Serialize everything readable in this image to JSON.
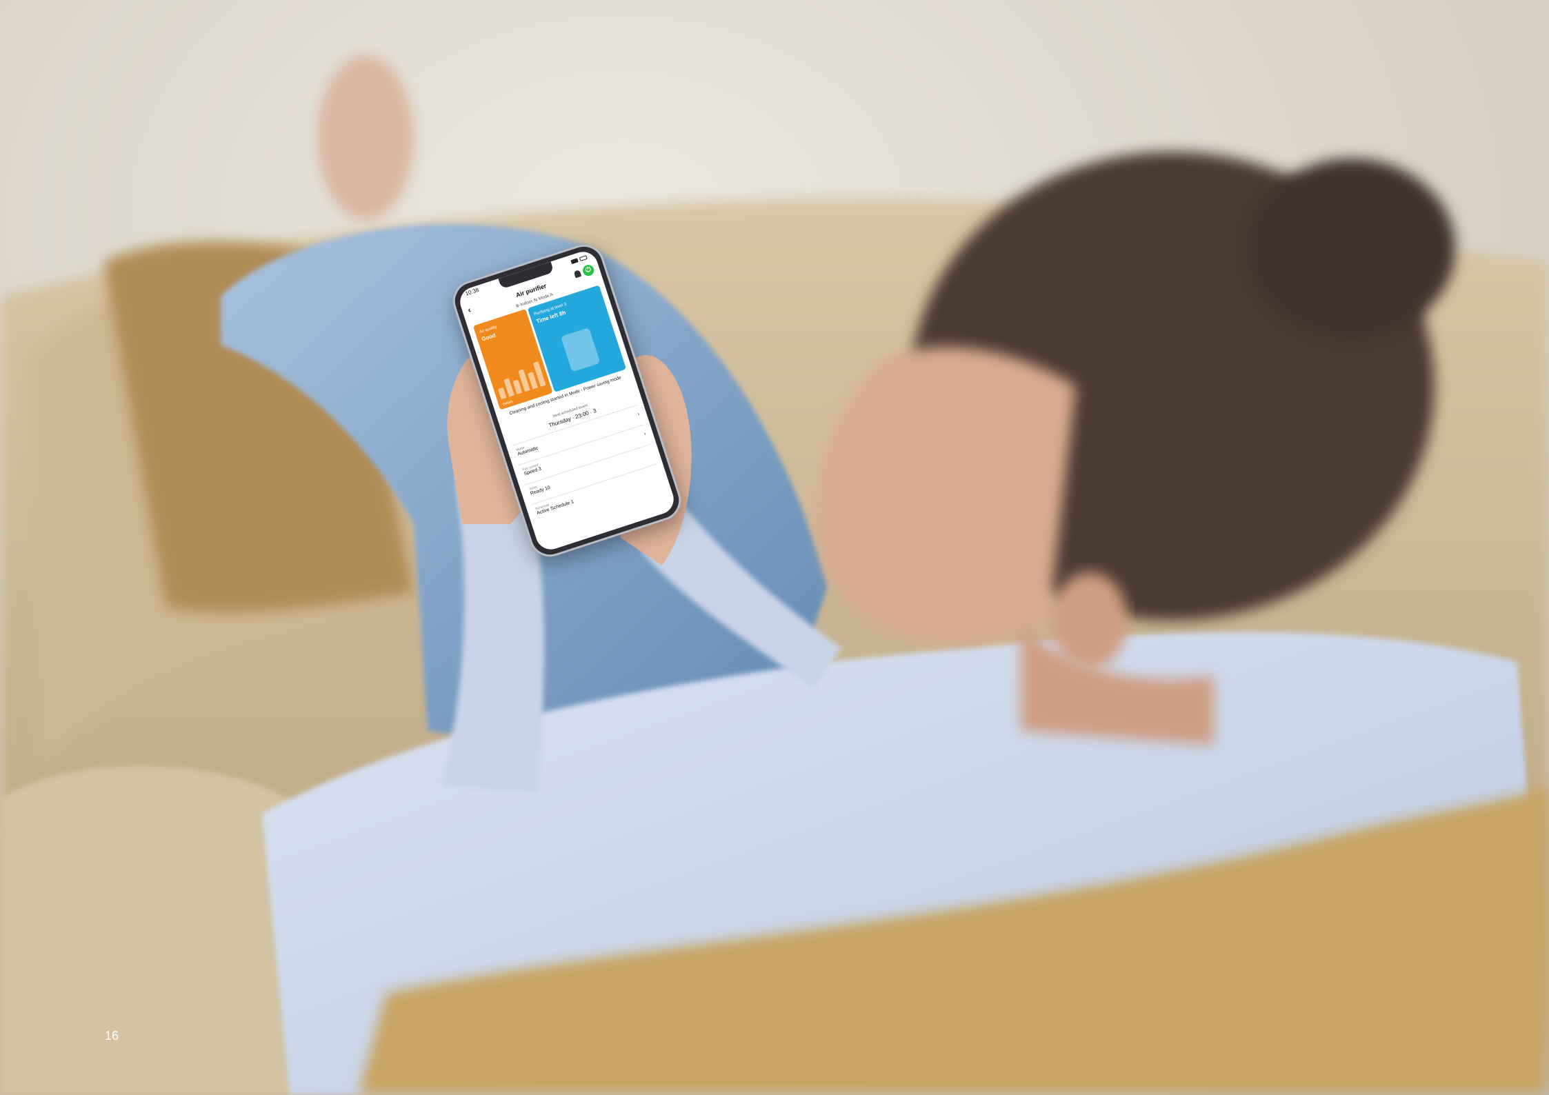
{
  "page_number": "16",
  "phone": {
    "status_time": "10:38",
    "screen_title": "Air purifier",
    "sub_header": "⊕ Indoor  ⇆ Mode A",
    "tile_left": {
      "label": "Air quality",
      "value": "Good",
      "foot": "Details"
    },
    "tile_right": {
      "label": "Purifying at level 3",
      "value": "Time left 8h",
      "foot": ""
    },
    "message": "Cleaning and cooling started in Mode - Power saving mode",
    "next_label": "Next scheduled event",
    "next_value": "Thursday · 23:00 · 3",
    "rows": [
      {
        "label": "Mode",
        "value": "Automatic"
      },
      {
        "label": "Fan speed",
        "value": "Speed 3"
      },
      {
        "label": "Timer",
        "value": "Ready 10"
      },
      {
        "label": "Schedule",
        "value": "Active Schedule 1"
      }
    ]
  },
  "colors": {
    "accent_orange": "#f18a1c",
    "accent_blue": "#24a7dc",
    "power_green": "#2fbf4a"
  }
}
